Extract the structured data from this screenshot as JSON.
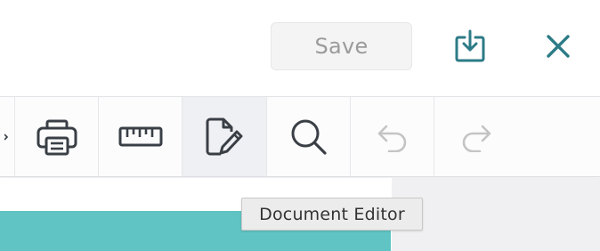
{
  "header": {
    "save_label": "Save",
    "download_icon": "download-icon",
    "close_icon": "close-icon"
  },
  "toolbar": {
    "items": [
      {
        "icon": "chevron-right-icon",
        "enabled": true
      },
      {
        "icon": "printer-icon",
        "enabled": true
      },
      {
        "icon": "ruler-icon",
        "enabled": true
      },
      {
        "icon": "document-edit-icon",
        "enabled": true,
        "active": true
      },
      {
        "icon": "search-icon",
        "enabled": true
      },
      {
        "icon": "undo-icon",
        "enabled": false
      },
      {
        "icon": "redo-icon",
        "enabled": false
      }
    ]
  },
  "tooltip": {
    "text": "Document Editor"
  },
  "colors": {
    "accent_teal": "#2c7b86",
    "band_teal": "#5fc4c3",
    "icon_dark": "#3a3f46",
    "icon_disabled": "#c4c4c4",
    "save_text_disabled": "#9b9b9b"
  }
}
